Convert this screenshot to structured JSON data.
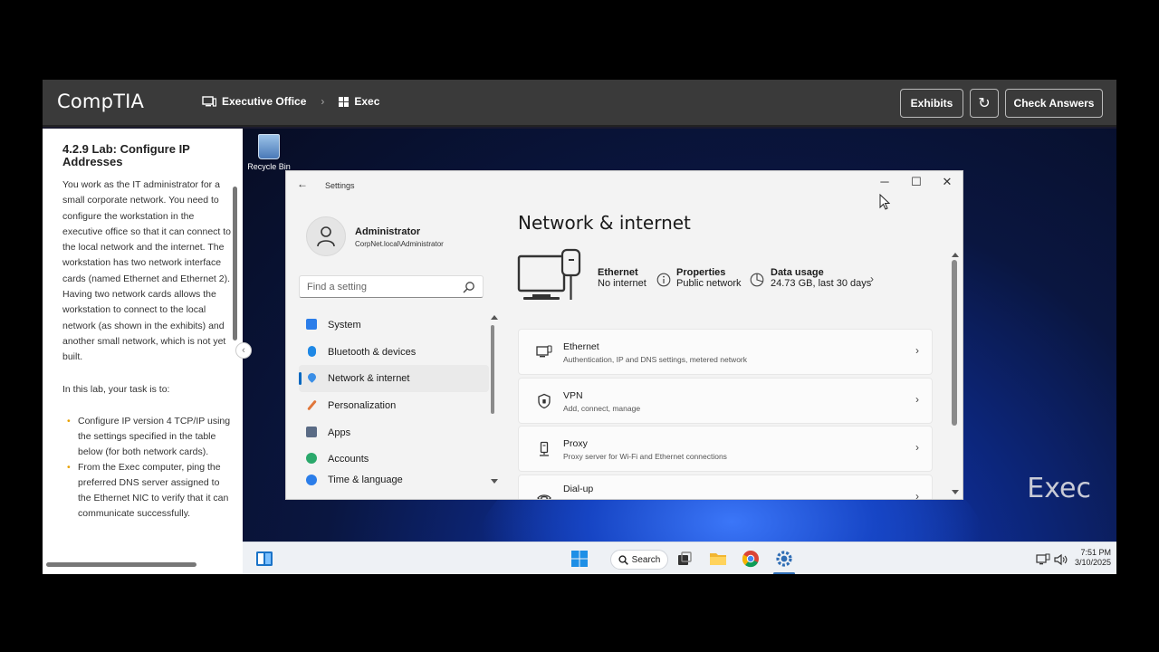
{
  "topbar": {
    "logo": "CompTIA",
    "crumb_location": "Executive Office",
    "crumb_separator": "›",
    "crumb_computer": "Exec",
    "exhibits_label": "Exhibits",
    "refresh_glyph": "↻",
    "check_answers_label": "Check Answers"
  },
  "lab": {
    "title": "4.2.9 Lab: Configure IP Addresses",
    "intro": "You work as the IT administrator for a small corporate network. You need to configure the workstation in the executive office so that it can connect to the local network and the internet. The workstation has two network interface cards (named Ethernet and Ethernet 2). Having two network cards allows the workstation to connect to the local network (as shown in the exhibits) and another small network, which is not yet built.",
    "task_intro": "In this lab, your task is to:",
    "tasks": [
      "Configure IP version 4 TCP/IP using the settings specified in the table below (for both network cards).",
      "From the Exec computer, ping the preferred DNS server assigned to the Ethernet NIC to verify that it can communicate successfully."
    ],
    "collapse_glyph": "‹"
  },
  "desktop": {
    "recycle_label": "Recycle Bin",
    "watermark": "Exec"
  },
  "taskbar": {
    "search_label": "Search",
    "time": "7:51 PM",
    "date": "3/10/2025"
  },
  "settings": {
    "window_title": "Settings",
    "back_glyph": "←",
    "minimize_glyph": "─",
    "maximize_glyph": "☐",
    "close_glyph": "✕",
    "user_name": "Administrator",
    "user_account": "CorpNet.local\\Administrator",
    "search_placeholder": "Find a setting",
    "nav": [
      {
        "label": "System",
        "color": "#2b7de9"
      },
      {
        "label": "Bluetooth & devices",
        "color": "#1f88e5"
      },
      {
        "label": "Network & internet",
        "color": "#3a8ee6"
      },
      {
        "label": "Personalization",
        "color": "#e0763a"
      },
      {
        "label": "Apps",
        "color": "#5a6b85"
      },
      {
        "label": "Accounts",
        "color": "#2aa86b"
      },
      {
        "label": "Time & language",
        "color": "#2b7de9"
      }
    ],
    "page_title": "Network & internet",
    "status": {
      "adapter": "Ethernet",
      "adapter_state": "No internet",
      "properties": "Properties",
      "properties_value": "Public network",
      "data_usage": "Data usage",
      "data_usage_value": "24.73 GB, last 30 days"
    },
    "cards": [
      {
        "title": "Ethernet",
        "sub": "Authentication, IP and DNS settings, metered network"
      },
      {
        "title": "VPN",
        "sub": "Add, connect, manage"
      },
      {
        "title": "Proxy",
        "sub": "Proxy server for Wi-Fi and Ethernet connections"
      },
      {
        "title": "Dial-up",
        "sub": ""
      }
    ],
    "chevron_glyph": "›"
  }
}
